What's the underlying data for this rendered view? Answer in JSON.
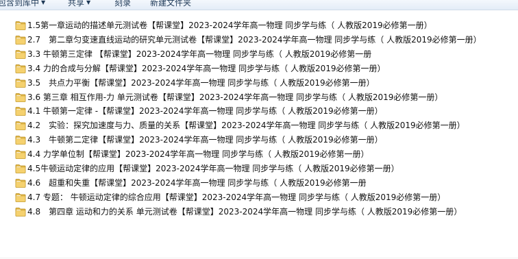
{
  "toolbar": {
    "include_label": "包含到库中",
    "share_label": "共享",
    "burn_label": "刻录",
    "new_folder_label": "新建文件夹",
    "dropdown_arrow": "▼"
  },
  "folder_icon": "folder-icon",
  "files": [
    "1.5第一章运动的描述单元测试卷【帮课堂】2023-2024学年高一物理 同步学与练（ 人教版2019必修第一册）",
    "2.7　第二章匀变速直线运动的研究单元测试卷【帮课堂】2023-2024学年高一物理 同步学与练（ 人教版2019必修第一册）",
    "3.3 牛顿第三定律 【帮课堂】2023-2024学年高一物理 同步学与练（ 人教版2019必修第一册",
    "3.4 力的合成与分解【帮课堂】2023-2024学年高一物理 同步学与练（ 人教版2019必修第一册）",
    "3.5　共点力平衡【帮课堂】2023-2024学年高一物理 同步学与练（ 人教版2019必修第一册）",
    "3.6 第三章 相互作用-力 单元测试卷【帮课堂】2023-2024学年高一物理 同步学与练（ 人教版2019必修第一册）",
    "4.1 牛顿第一定律 -【帮课堂】2023-2024学年高一物理 同步学与练（ 人教版2019必修第一册）",
    "4.2　实验：探究加速度与力、质量的关系【帮课堂】2023-2024学年高一物理 同步学与练（ 人教版2019必修第一册）",
    "4.3　牛顿第二定律【帮课堂】2023-2024学年高一物理 同步学与练（ 人教版2019必修第一册）",
    "4.4 力学单位制【帮课堂】2023-2024学年高一物理 同步学与练（ 人教版2019必修第一册）",
    "4.5牛顿运动定律的应用【帮课堂】2023-2024学年高一物理 同步学与练（ 人教版2019必修第一册）",
    "4.6　超重和失重【帮课堂】2023-2024学年高一物理 同步学与练（ 人教版2019必修第一册",
    "4.7 专题： 牛顿运动定律的综合应用【帮课堂】2023-2024学年高一物理 同步学与练（ 人教版2019必修第一册）",
    "4.8　第四章 运动和力的关系 单元测试卷【帮课堂】2023-2024学年高一物理 同步学与练（ 人教版2019必修第一册）"
  ]
}
